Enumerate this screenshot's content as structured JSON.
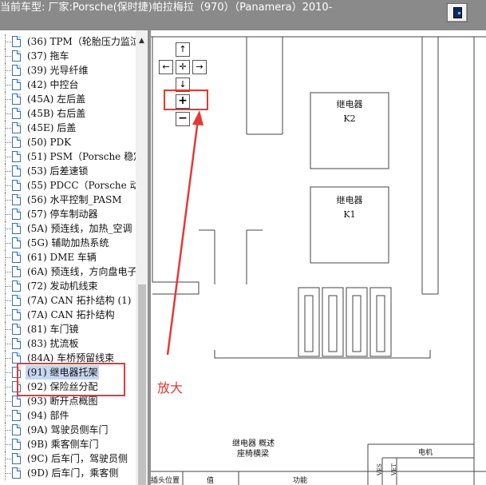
{
  "titlebar": {
    "text": "当前车型:  厂家:Porsche(保时捷)帕拉梅拉（970）（Panamera）2010-"
  },
  "tree": {
    "items": [
      {
        "label": "(36) TPM（轮胎压力监泣"
      },
      {
        "label": "(37) 拖车"
      },
      {
        "label": "(39) 光导纤维"
      },
      {
        "label": "(42) 中控台"
      },
      {
        "label": "(45A) 左后盖"
      },
      {
        "label": "(45B) 右后盖"
      },
      {
        "label": "(45E) 后盖"
      },
      {
        "label": "(50) PDK"
      },
      {
        "label": "(51) PSM（Porsche 稳定"
      },
      {
        "label": "(53) 后差速锁"
      },
      {
        "label": "(55) PDCC（Porsche 动力"
      },
      {
        "label": "(56) 水平控制_PASM"
      },
      {
        "label": "(57) 停车制动器"
      },
      {
        "label": "(5A) 预连线，加热_空调"
      },
      {
        "label": "(5G) 辅助加热系统"
      },
      {
        "label": "(61) DME 车辆"
      },
      {
        "label": "(6A) 预连线，方向盘电子"
      },
      {
        "label": "(72) 发动机线束"
      },
      {
        "label": "(7A) CAN 拓扑结构 (1)"
      },
      {
        "label": "(7A) CAN 拓扑结构"
      },
      {
        "label": "(81) 车门镜"
      },
      {
        "label": "(83) 扰流板"
      },
      {
        "label": "(84A) 车桥预留线束"
      },
      {
        "label": "(91) 继电器托架"
      },
      {
        "label": "(92) 保险丝分配"
      },
      {
        "label": "(93) 断开点概图"
      },
      {
        "label": "(94) 部件"
      },
      {
        "label": "(9A) 驾驶员侧车门"
      },
      {
        "label": "(9B) 乘客侧车门"
      },
      {
        "label": "(9C) 后车门，驾驶员侧"
      },
      {
        "label": "(9D) 后车门，乘客侧"
      }
    ],
    "selected_index": 23
  },
  "drawing": {
    "nav": {
      "up": "↑",
      "left": "←",
      "center": "✛",
      "right": "→",
      "down": "↓",
      "zoom_in": "+",
      "zoom_out": "−"
    },
    "relay_k2": {
      "name": "继电器",
      "code": "K2"
    },
    "relay_k1": {
      "name": "继电器",
      "code": "K1"
    },
    "footer_title": "继电器 概述",
    "footer_subtitle": "座椅横梁",
    "table_headers": [
      "插头位置",
      "值",
      "功能",
      "电机"
    ],
    "vertical_labels": [
      "VES",
      "VET"
    ]
  },
  "annotation": {
    "text": "放大",
    "color": "#e53935"
  }
}
